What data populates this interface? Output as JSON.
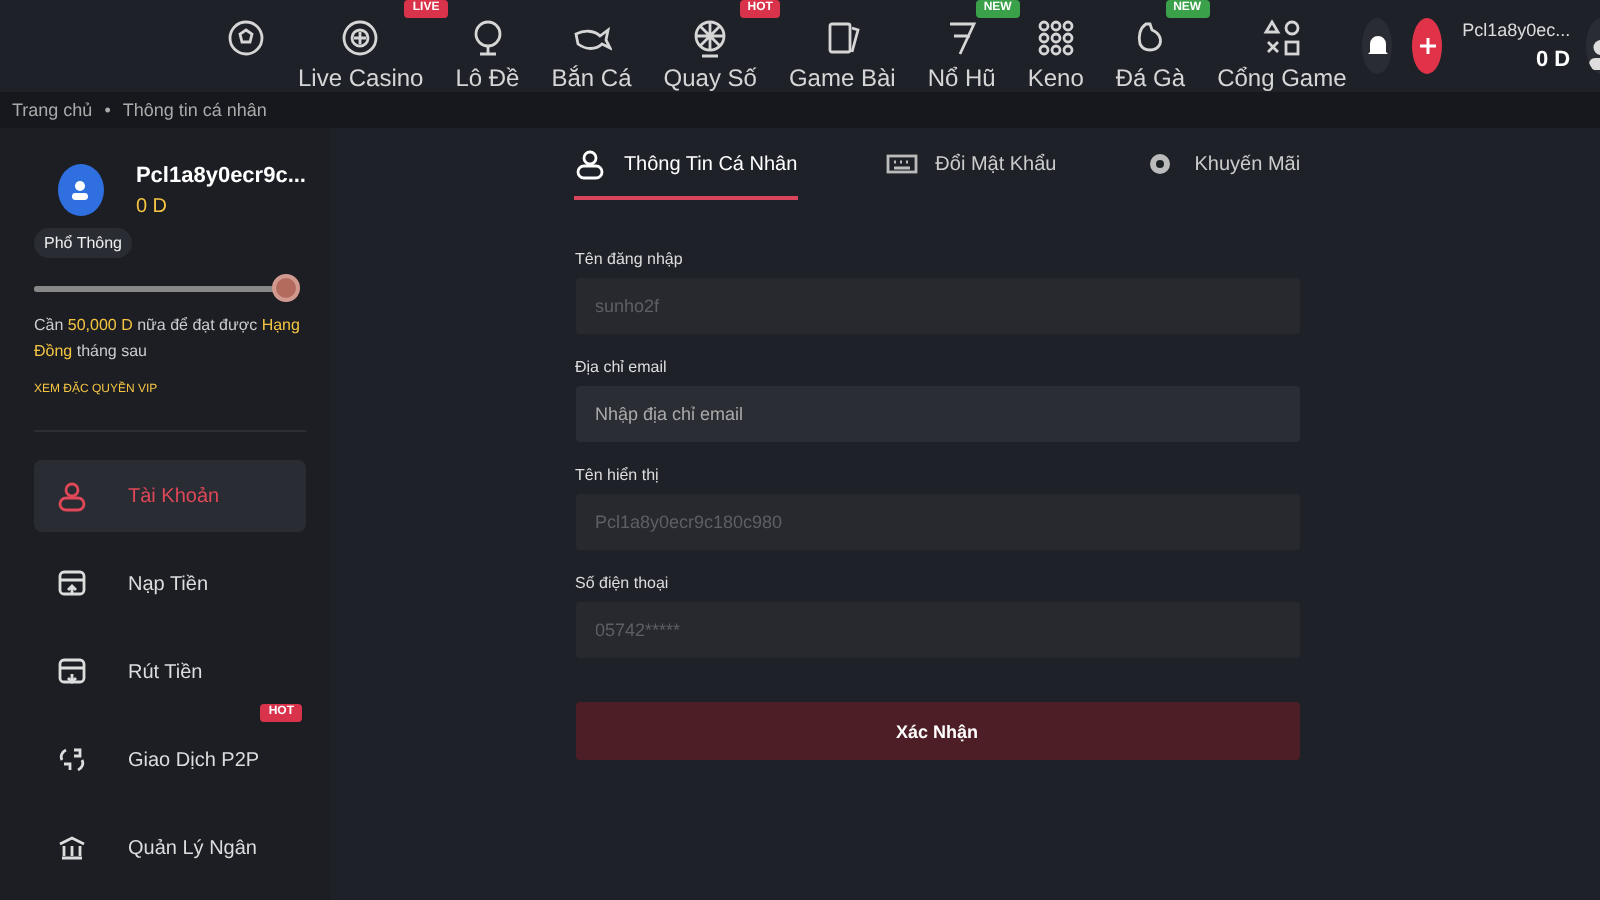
{
  "nav": [
    {
      "label": "Live Casino",
      "badge": "LIVE"
    },
    {
      "label": "Lô Đề"
    },
    {
      "label": "Bắn Cá"
    },
    {
      "label": "Quay Số",
      "badge": "HOT"
    },
    {
      "label": "Game Bài"
    },
    {
      "label": "Nổ Hũ",
      "badge": "NEW"
    },
    {
      "label": "Keno"
    },
    {
      "label": "Đá Gà",
      "badge": "NEW"
    },
    {
      "label": "Cổng Game"
    }
  ],
  "account": {
    "username": "Pcl1a8y0ec...",
    "balance": "0 D"
  },
  "breadcrumb": {
    "items": [
      "Trang chủ",
      "Thông tin cá nhân"
    ],
    "separator": "•"
  },
  "profile": {
    "name": "Pcl1a8y0ecr9c...",
    "balance": "0 D",
    "tier": "Phổ Thông",
    "level": 0.97,
    "note": "Cần **50,000 D** nữa để đạt được **Hạng Đồng** tháng sau",
    "vip_link": "XEM ĐẶC QUYỀN VIP"
  },
  "menu": [
    {
      "label": "Tài Khoản",
      "selected": true
    },
    {
      "label": "Nạp Tiền",
      "selected": false
    },
    {
      "label": "Rút Tiền",
      "selected": false
    },
    {
      "label": "Giao Dịch P2P",
      "selected": false,
      "badge": "HOT"
    },
    {
      "label": "Quản Lý Ngân",
      "selected": false
    }
  ],
  "tabs": [
    {
      "label": "Thông Tin Cá Nhân",
      "selected": true
    },
    {
      "label": "Đổi Mật Khẩu",
      "selected": false
    },
    {
      "label": "Khuyến Mãi",
      "selected": false
    }
  ],
  "fields": [
    {
      "label": "Tên đăng nhập",
      "value": "sunho2f",
      "disabled": true
    },
    {
      "label": "Địa chỉ email",
      "placeholder": "Nhập địa chỉ email",
      "disabled": false
    },
    {
      "label": "Tên hiển thị",
      "value": "Pcl1a8y0ecr9c180c980",
      "disabled": true
    },
    {
      "label": "Số điện thoại",
      "value": "05742*****",
      "disabled": true
    }
  ],
  "submit": "Xác Nhận"
}
